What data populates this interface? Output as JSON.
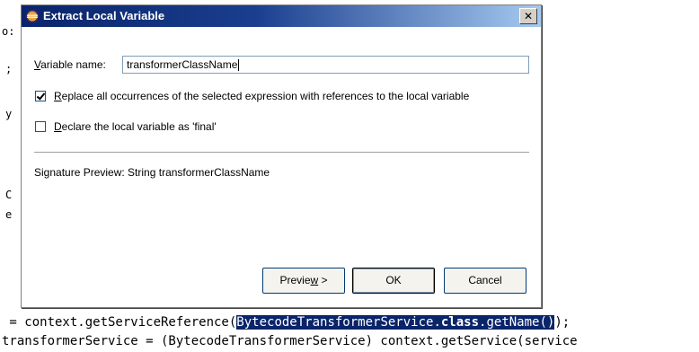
{
  "editor": {
    "left_fragments": [
      "o:",
      ";",
      "y",
      "C",
      "e"
    ],
    "line1": {
      "prefix": " = context.getServiceReference(",
      "selected_part1": "BytecodeTransformerService.",
      "selected_keyword": "class",
      "selected_part2": ".getName()",
      "suffix": ");"
    },
    "line2": "transformerService = (BytecodeTransformerService) context.getService(service"
  },
  "dialog": {
    "title": "Extract Local Variable",
    "close_glyph": "✕",
    "variable_name": {
      "mnemonic": "V",
      "label_rest": "ariable name:",
      "value": "transformerClassName"
    },
    "replace_all": {
      "checked": true,
      "mnemonic": "R",
      "label_rest": "eplace all occurrences of the selected expression with references to the local variable"
    },
    "declare_final": {
      "checked": false,
      "mnemonic": "D",
      "label_rest": "eclare the local variable as 'final'"
    },
    "signature_preview": "Signature Preview: String transformerClassName",
    "buttons": {
      "preview_pre": "Previe",
      "preview_mnemonic": "w",
      "preview_post": " >",
      "ok": "OK",
      "cancel": "Cancel"
    }
  }
}
